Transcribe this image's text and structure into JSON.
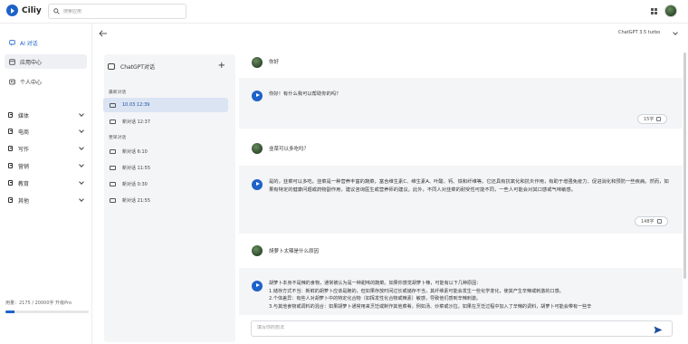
{
  "app": {
    "name": "Ciliy",
    "accent": "#1e62c8"
  },
  "search": {
    "placeholder": "搜索应用"
  },
  "nav": {
    "items": [
      {
        "label": "AI 对话",
        "icon": "chat-icon"
      },
      {
        "label": "应用中心",
        "icon": "apps-icon"
      },
      {
        "label": "个人中心",
        "icon": "profile-icon"
      }
    ],
    "categories": [
      {
        "label": "媒体"
      },
      {
        "label": "电商"
      },
      {
        "label": "写作"
      },
      {
        "label": "营销"
      },
      {
        "label": "教育"
      },
      {
        "label": "其他"
      }
    ]
  },
  "usage": {
    "text": "用量：2175 / 20000字 升级Pro",
    "fraction": 0.1088
  },
  "conversations": {
    "header": "ChatGPT对话",
    "recent_label": "最新对话",
    "earlier_label": "更早对话",
    "recent": [
      "10.03 12:39",
      "新对话 12:37"
    ],
    "earlier": [
      "新对话 6:10",
      "新对话 11:55",
      "新对话 0:30",
      "新对话 21:55"
    ]
  },
  "model": {
    "selected": "ChatGPT 3.5 turbo"
  },
  "messages": [
    {
      "role": "user",
      "text": "你好"
    },
    {
      "role": "ai",
      "text": "你好！有什么我可以帮助你的吗？",
      "count": "15字"
    },
    {
      "role": "user",
      "text": "韭菜可以多吃吗？"
    },
    {
      "role": "ai",
      "text": "是的，韭菜可以多吃。韭菜是一种营养丰富的蔬菜，富含维生素C、维生素A、叶酸、钙、铁和纤维等。它还具有抗氧化和抗炎作用，有助于增强免疫力、促进消化和预防一些疾病。然而，如果有特定的健康问题或药物副作用，建议咨询医生或营养师的建议。此外，不同人对韭菜的耐受性可能不同，一些人可能会对其口感或气味敏感。",
      "count": "148字"
    },
    {
      "role": "user",
      "text": "胡萝卜太辣是什么原因"
    },
    {
      "role": "ai",
      "text": "胡萝卜本身不是辣的食物，通常被认为是一种甜味的蔬菜。如果你感觉胡萝卜辣，可能有以下几种原因：\n1.储存方式不当：新鲜的胡萝卜应该是脆的，但如果存放时间过长或储存不当，其纤维素可能会发生一些化学变化，使其产生辛辣或刺激的口感。\n2.个体差异：有些人对胡萝卜中的特定化合物（如挥发性化合物或辣素）敏感，导致他们感到辛辣刺激。\n3.与其他食物或调料的混合：如果胡萝卜通常用来烹饪或制作其他菜肴，例如汤、炒菜或沙拉。如果在烹饪过程中加入了辛辣的调料，胡萝卜可能会带有一些辛"
    }
  ],
  "composer": {
    "placeholder": "填写你的想法"
  }
}
